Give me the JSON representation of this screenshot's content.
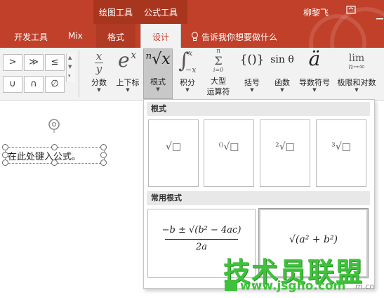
{
  "title_bar": {
    "contextual_drawing": "绘图工具",
    "contextual_formula": "公式工具",
    "user_name": "柳黎飞",
    "restore_icon": "ribbon-display-icon",
    "minimize_icon": "minimize-icon"
  },
  "tabs": {
    "developer": "开发工具",
    "mix": "Mix",
    "format": "格式",
    "design": "设计",
    "tell_me": "告诉我你想要做什么"
  },
  "symbols": {
    "row1": [
      ">",
      "≫",
      "≤"
    ],
    "row2": [
      "∪",
      "∩",
      "∅"
    ]
  },
  "ribbon": {
    "fraction": {
      "icon_top": "x",
      "icon_bottom": "y",
      "label": "分数"
    },
    "script": {
      "icon": "e",
      "icon_sup": "x",
      "label": "上下标"
    },
    "radical": {
      "icon": "ⁿ√x",
      "label": "根式"
    },
    "integral": {
      "icon": "∫",
      "icon_upper": "x",
      "icon_lower": "−x",
      "label": "积分"
    },
    "large_operator": {
      "icon_upper": "n",
      "icon": "Σ",
      "icon_lower": "i=0",
      "label_line1": "大型",
      "label_line2": "运算符"
    },
    "bracket": {
      "icon": "{()}",
      "label": "括号"
    },
    "function": {
      "icon": "sin θ",
      "label": "函数"
    },
    "accent": {
      "icon": "ä",
      "label": "导数符号"
    },
    "limit": {
      "icon_top": "lim",
      "icon_bottom": "n→∞",
      "label": "极限和对数"
    }
  },
  "document": {
    "placeholder": "在此处键入公式。"
  },
  "gallery": {
    "section_radicals": "根式",
    "section_common": "常用根式",
    "radicals": [
      "√□",
      "⁽⁾√□",
      "²√□",
      "³√□"
    ],
    "quadratic": {
      "numerator": "−b ± √(b² − 4ac)",
      "denominator": "2a"
    },
    "hypotenuse": "√(a² + b²)"
  },
  "watermark": {
    "main": "技术员联盟",
    "url": "www.jsgho.com",
    "sub": "m.cn"
  },
  "colors": {
    "accent": "#c1402a",
    "watermark": "#3ec23b"
  }
}
